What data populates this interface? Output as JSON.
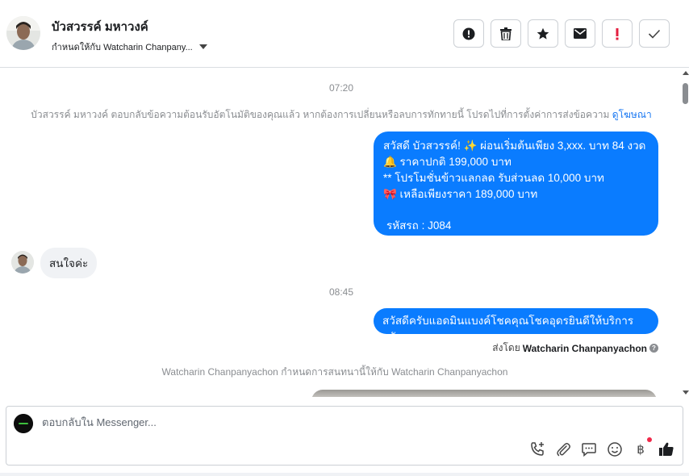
{
  "header": {
    "contact_name": "บัวสวรรค์ มหาวงค์",
    "assigned_to": "กำหนดให้กับ Watcharin Chanpany..."
  },
  "actions": [
    {
      "icon": "alert-circle-icon"
    },
    {
      "icon": "trash-icon"
    },
    {
      "icon": "star-icon"
    },
    {
      "icon": "envelope-icon"
    },
    {
      "icon": "exclamation-icon"
    },
    {
      "icon": "checkmark-icon"
    }
  ],
  "thread": {
    "time_1": "07:20",
    "auto_reply_notice": "บัวสวรรค์ มหาวงค์ ตอบกลับข้อความต้อนรับอัตโนมัติของคุณแล้ว หากต้องการเปลี่ยนหรือลบการทักทายนี้ โปรดไปที่การตั้งค่าการส่งข้อความ",
    "auto_reply_link": "ดูโฆษณา",
    "promo_message": {
      "line1": "สวัสดี บัวสวรรค์! ✨  ผ่อนเริ่มต้นเพียง 3,xxx. บาท 84 งวด",
      "line2": "🔔 ราคาปกติ 199,000 บาท",
      "line3": "** โปรโมชั่นข้าวแลกลด รับส่วนลด 10,000 บาท",
      "line4": "🎀  เหลือเพียงราคา 189,000 บาท",
      "line5": "รหัสรถ : J084"
    },
    "customer_reply": "สนใจค่ะ",
    "time_2": "08:45",
    "admin_reply": "สวัสดีครับแอดมินแบงค์โชคคุณโชคอุดรยินดีให้บริการครับ",
    "sent_by_prefix": "ส่งโดย",
    "sent_by_name": "Watcharin Chanpanyachon",
    "assignment_notice": "Watcharin Chanpanyachon กำหนดการสนทนานี้ให้กับ Watcharin Chanpanyachon"
  },
  "composer": {
    "placeholder": "ตอบกลับใน Messenger...",
    "tools": [
      "call-add-icon",
      "paperclip-icon",
      "chat-bubble-icon",
      "emoji-icon",
      "baht-icon",
      "thumbs-up-icon"
    ]
  },
  "colors": {
    "accent": "#0a7cff",
    "link": "#1877f2",
    "alert_red": "#e41e3f",
    "notification_dot": "#f02849"
  }
}
